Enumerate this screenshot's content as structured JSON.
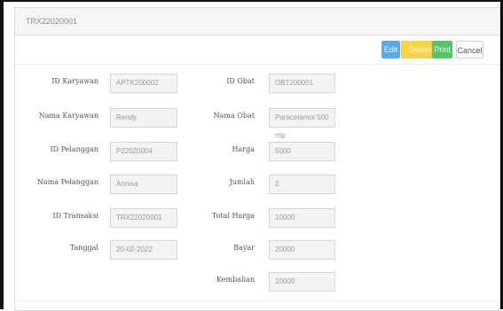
{
  "panel": {
    "title": "TRX22020001"
  },
  "buttons": {
    "edit": "Edit",
    "delete": "Delete",
    "print": "Print",
    "cancel": "Cancel"
  },
  "form": {
    "id_karyawan": {
      "label": "ID Karyawan",
      "value": "APTK200002"
    },
    "nama_karyawan": {
      "label": "Nama Karyawan",
      "value": "Rendy"
    },
    "id_pelanggan": {
      "label": "ID Pelanggan",
      "value": "P22020004"
    },
    "nama_pelanggan": {
      "label": "Nama Pelanggan",
      "value": "Annisa"
    },
    "id_transaksi": {
      "label": "ID Transaksi",
      "value": "TRX22020001"
    },
    "tanggal": {
      "label": "Tanggal",
      "value": "20-02-2022"
    },
    "id_obat": {
      "label": "ID Obat",
      "value": "OBT200001"
    },
    "nama_obat": {
      "label": "Nama Obat",
      "value": "Paracetamol 500 mg"
    },
    "harga": {
      "label": "Harga",
      "value": "5000"
    },
    "jumlah": {
      "label": "Jumlah",
      "value": "2"
    },
    "total_harga": {
      "label": "Total Harga",
      "value": "10000"
    },
    "bayar": {
      "label": "Bayar",
      "value": "20000"
    },
    "kembalian": {
      "label": "Kembalian",
      "value": "10000"
    }
  }
}
